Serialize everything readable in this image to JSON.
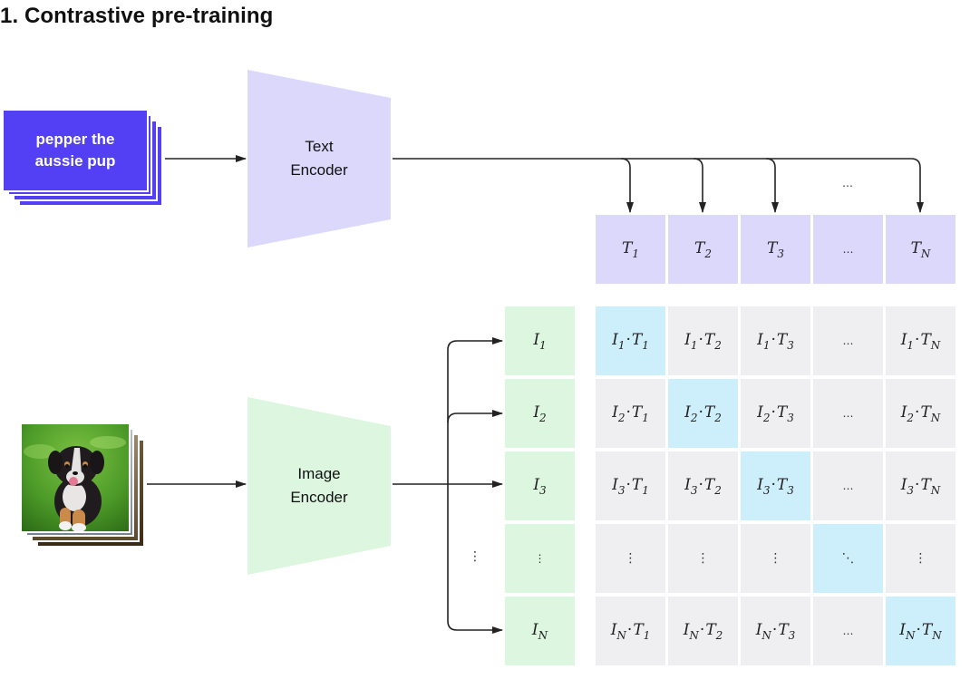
{
  "title": "1. Contrastive pre-training",
  "text_input": {
    "label_line1": "pepper the",
    "label_line2": "aussie pup",
    "color": "#5340f5"
  },
  "image_input": {
    "description": "photo of a black, white and tan Australian Shepherd puppy sitting on green grass"
  },
  "text_encoder": {
    "line1": "Text",
    "line2": "Encoder",
    "color": "#dbd8fc"
  },
  "image_encoder": {
    "line1": "Image",
    "line2": "Encoder",
    "color": "#dcf6e0"
  },
  "arrow_dots": "…",
  "left_vdots": "⋮",
  "text_embeddings": [
    {
      "base": "T",
      "sub": "1"
    },
    {
      "base": "T",
      "sub": "2"
    },
    {
      "base": "T",
      "sub": "3"
    },
    {
      "base": "…",
      "sub": ""
    },
    {
      "base": "T",
      "sub": "N"
    }
  ],
  "image_embeddings": [
    {
      "base": "I",
      "sub": "1"
    },
    {
      "base": "I",
      "sub": "2"
    },
    {
      "base": "I",
      "sub": "3"
    },
    {
      "base": "⋮",
      "sub": ""
    },
    {
      "base": "I",
      "sub": "N"
    }
  ],
  "matrix": [
    [
      {
        "i": "1",
        "t": "1"
      },
      {
        "i": "1",
        "t": "2"
      },
      {
        "i": "1",
        "t": "3"
      },
      {
        "dots": "…"
      },
      {
        "i": "1",
        "t": "N"
      }
    ],
    [
      {
        "i": "2",
        "t": "1"
      },
      {
        "i": "2",
        "t": "2"
      },
      {
        "i": "2",
        "t": "3"
      },
      {
        "dots": "…"
      },
      {
        "i": "2",
        "t": "N"
      }
    ],
    [
      {
        "i": "3",
        "t": "1"
      },
      {
        "i": "3",
        "t": "2"
      },
      {
        "i": "3",
        "t": "3"
      },
      {
        "dots": "…"
      },
      {
        "i": "3",
        "t": "N"
      }
    ],
    [
      {
        "dots": "⋮"
      },
      {
        "dots": "⋮"
      },
      {
        "dots": "⋮"
      },
      {
        "dots": "⋱"
      },
      {
        "dots": "⋮"
      }
    ],
    [
      {
        "i": "N",
        "t": "1"
      },
      {
        "i": "N",
        "t": "2"
      },
      {
        "i": "N",
        "t": "3"
      },
      {
        "dots": "…"
      },
      {
        "i": "N",
        "t": "N"
      }
    ]
  ],
  "colors": {
    "text_embedding": "#dbd8fc",
    "image_embedding": "#dcf6e0",
    "matrix_cell": "#efeff1",
    "matrix_diagonal": "#cdeffb",
    "arrow": "#222222"
  }
}
